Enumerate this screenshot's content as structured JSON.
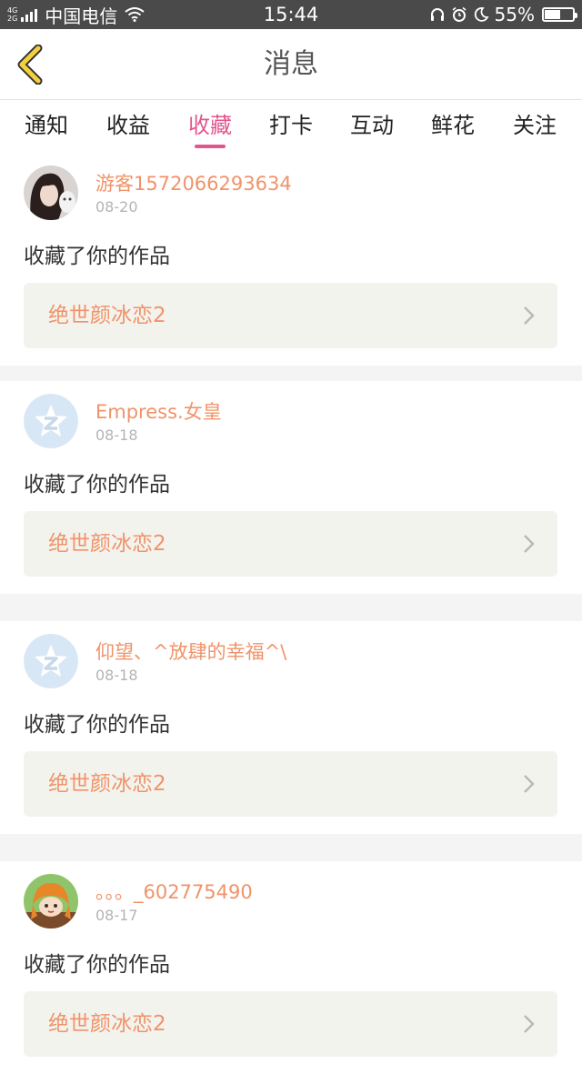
{
  "status_bar": {
    "network": "4G 2G",
    "carrier": "中国电信",
    "time": "15:44",
    "battery_percent": "55%",
    "battery_level": 0.55
  },
  "header": {
    "title": "消息",
    "back_icon": "chevron-left-icon",
    "accent_color": "#f4d03f"
  },
  "tabs": [
    {
      "label": "通知",
      "active": false
    },
    {
      "label": "收益",
      "active": false
    },
    {
      "label": "收藏",
      "active": true
    },
    {
      "label": "打卡",
      "active": false
    },
    {
      "label": "互动",
      "active": false
    },
    {
      "label": "鲜花",
      "active": false
    },
    {
      "label": "关注",
      "active": false
    }
  ],
  "colors": {
    "active_tab": "#e2568e",
    "username": "#f0936a",
    "work_title": "#f0936a"
  },
  "notifications": [
    {
      "username": "游客1572066293634",
      "date": "08-20",
      "action": "收藏了你的作品",
      "work_title": "绝世颜冰恋2",
      "avatar": "photo-avatar"
    },
    {
      "username": "Empress.女皇",
      "date": "08-18",
      "action": "收藏了你的作品",
      "work_title": "绝世颜冰恋2",
      "avatar": "qq-default-avatar"
    },
    {
      "username": "仰望、^放肆的幸福^\\",
      "date": "08-18",
      "action": "收藏了你的作品",
      "work_title": "绝世颜冰恋2",
      "avatar": "qq-default-avatar"
    },
    {
      "username": "。。。_602775490",
      "date": "08-17",
      "action": "收藏了你的作品",
      "work_title": "绝世颜冰恋2",
      "avatar": "anime-avatar"
    }
  ]
}
